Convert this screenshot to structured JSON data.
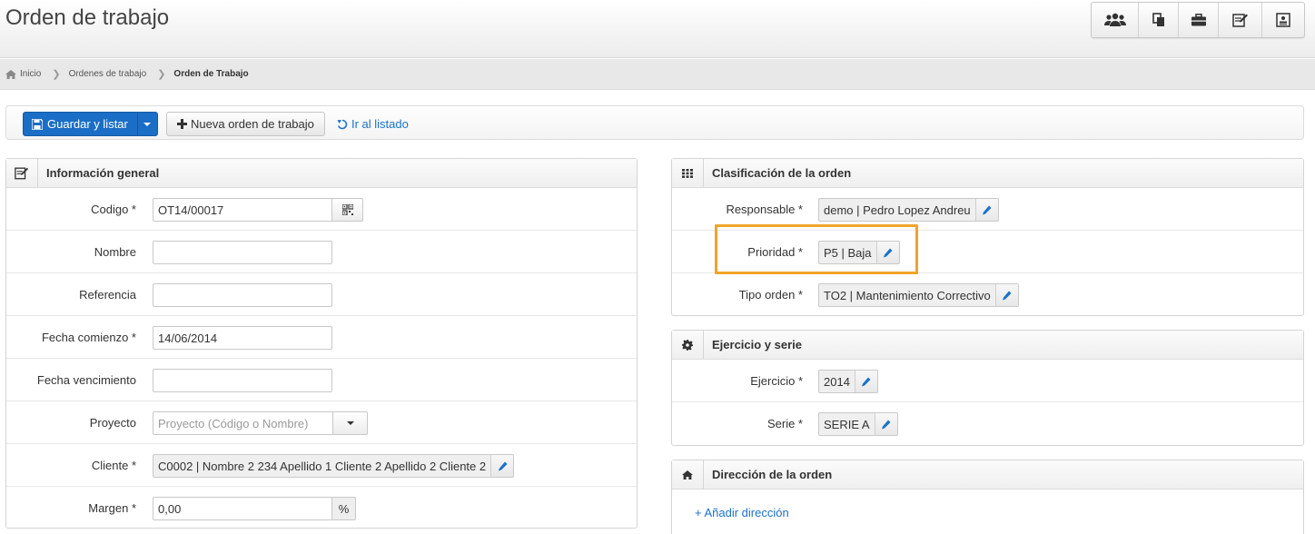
{
  "header": {
    "title": "Orden de trabajo",
    "icons": [
      "users-icon",
      "copy-document-icon",
      "briefcase-icon",
      "edit-note-icon",
      "contact-card-icon"
    ]
  },
  "breadcrumb": {
    "home": "Inicio",
    "level1": "Ordenes de trabajo",
    "current": "Orden de Trabajo"
  },
  "toolbar": {
    "save_label": "Guardar y listar",
    "new_label": "Nueva orden de trabajo",
    "list_label": "Ir al listado"
  },
  "general": {
    "title": "Información general",
    "codigo": {
      "label": "Codigo *",
      "value": "OT14/00017"
    },
    "nombre": {
      "label": "Nombre",
      "value": ""
    },
    "referencia": {
      "label": "Referencia",
      "value": ""
    },
    "fecha_comienzo": {
      "label": "Fecha comienzo *",
      "value": "14/06/2014"
    },
    "fecha_vencimiento": {
      "label": "Fecha vencimiento",
      "value": ""
    },
    "proyecto": {
      "label": "Proyecto",
      "placeholder": "Proyecto (Código o Nombre)"
    },
    "cliente": {
      "label": "Cliente *",
      "value": "C0002 | Nombre 2 234 Apellido 1 Cliente 2 Apellido 2 Cliente 2"
    },
    "margen": {
      "label": "Margen *",
      "value": "0,00",
      "unit": "%"
    }
  },
  "clasificacion": {
    "title": "Clasificación de la orden",
    "responsable": {
      "label": "Responsable *",
      "value": "demo | Pedro Lopez Andreu"
    },
    "prioridad": {
      "label": "Prioridad *",
      "value": "P5 | Baja"
    },
    "tipo": {
      "label": "Tipo orden *",
      "value": "TO2 | Mantenimiento Correctivo"
    }
  },
  "ejercicio": {
    "title": "Ejercicio y serie",
    "ejercicio": {
      "label": "Ejercicio *",
      "value": "2014"
    },
    "serie": {
      "label": "Serie *",
      "value": "SERIE A"
    }
  },
  "direccion": {
    "title": "Dirección de la orden",
    "add_label": "+ Añadir dirección"
  },
  "colors": {
    "primary": "#1b6ec6",
    "link": "#1b72c9",
    "highlight": "#f0a42a"
  }
}
